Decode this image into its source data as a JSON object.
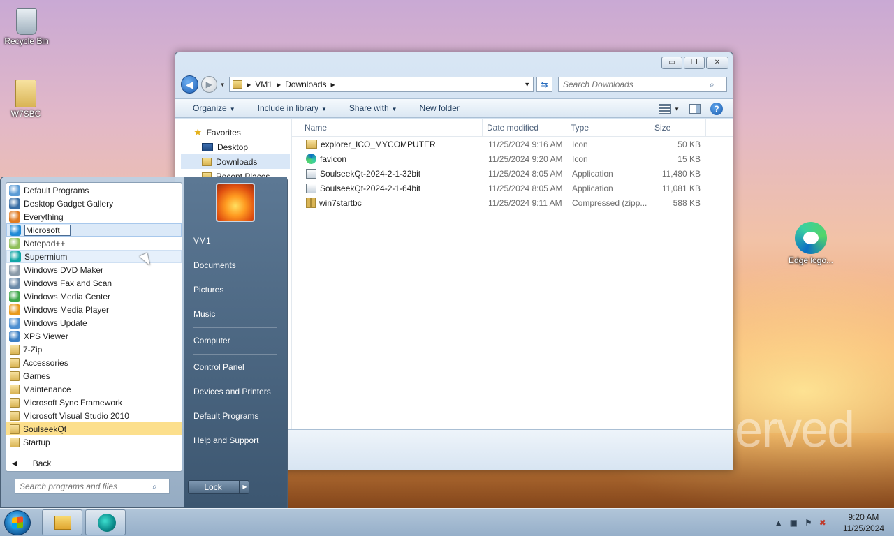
{
  "desktop": {
    "icons": [
      {
        "label": "Recycle Bin",
        "icon": "recycle-bin-icon"
      },
      {
        "label": "W7SBC",
        "icon": "folder-icon"
      },
      {
        "label": "Edge logo...",
        "icon": "edge-icon"
      }
    ],
    "wallpaper_text": "erved"
  },
  "explorer": {
    "controls": {
      "minimize": "▭",
      "maximize": "❐",
      "close": "✕"
    },
    "breadcrumb": [
      "VM1",
      "Downloads"
    ],
    "search_placeholder": "Search Downloads",
    "toolbar": {
      "organize": "Organize",
      "include_in_library": "Include in library",
      "share_with": "Share with",
      "new_folder": "New folder"
    },
    "nav": {
      "favorites": "Favorites",
      "items": [
        "Desktop",
        "Downloads",
        "Recent Places"
      ]
    },
    "columns": {
      "name": "Name",
      "date": "Date modified",
      "type": "Type",
      "size": "Size"
    },
    "files": [
      {
        "name": "explorer_ICO_MYCOMPUTER",
        "date": "11/25/2024 9:16 AM",
        "type": "Icon",
        "size": "50 KB",
        "icon": "folder"
      },
      {
        "name": "favicon",
        "date": "11/25/2024 9:20 AM",
        "type": "Icon",
        "size": "15 KB",
        "icon": "edge"
      },
      {
        "name": "SoulseekQt-2024-2-1-32bit",
        "date": "11/25/2024 8:05 AM",
        "type": "Application",
        "size": "11,480 KB",
        "icon": "setup"
      },
      {
        "name": "SoulseekQt-2024-2-1-64bit",
        "date": "11/25/2024 8:05 AM",
        "type": "Application",
        "size": "11,081 KB",
        "icon": "setup"
      },
      {
        "name": "win7startbc",
        "date": "11/25/2024 9:11 AM",
        "type": "Compressed (zipp...",
        "size": "588 KB",
        "icon": "zip"
      }
    ]
  },
  "start_menu": {
    "programs": [
      {
        "label": "Default Programs",
        "kind": "app",
        "color": "#5b9bd5"
      },
      {
        "label": "Desktop Gadget Gallery",
        "kind": "app",
        "color": "#3a6ea5"
      },
      {
        "label": "Everything",
        "kind": "app",
        "color": "#e07b22"
      },
      {
        "label": "Microsoft",
        "kind": "renaming",
        "color": "#1f8ad6"
      },
      {
        "label": "Notepad++",
        "kind": "app",
        "color": "#8fbf5a"
      },
      {
        "label": "Supermium",
        "kind": "highlight",
        "color": "#12a6a6"
      },
      {
        "label": "Windows DVD Maker",
        "kind": "app",
        "color": "#8a9aa8"
      },
      {
        "label": "Windows Fax and Scan",
        "kind": "app",
        "color": "#6b8aa8"
      },
      {
        "label": "Windows Media Center",
        "kind": "app",
        "color": "#3ea64a"
      },
      {
        "label": "Windows Media Player",
        "kind": "app",
        "color": "#e89a1c"
      },
      {
        "label": "Windows Update",
        "kind": "app",
        "color": "#4d8fd1"
      },
      {
        "label": "XPS Viewer",
        "kind": "app",
        "color": "#3b7fc4"
      },
      {
        "label": "7-Zip",
        "kind": "folder"
      },
      {
        "label": "Accessories",
        "kind": "folder"
      },
      {
        "label": "Games",
        "kind": "folder"
      },
      {
        "label": "Maintenance",
        "kind": "folder"
      },
      {
        "label": "Microsoft Sync Framework",
        "kind": "folder"
      },
      {
        "label": "Microsoft Visual Studio 2010",
        "kind": "folder"
      },
      {
        "label": "SoulseekQt",
        "kind": "open-folder"
      },
      {
        "label": "Startup",
        "kind": "folder"
      }
    ],
    "back": "Back",
    "search_placeholder": "Search programs and files",
    "places": [
      "VM1",
      "Documents",
      "Pictures",
      "Music",
      "Computer",
      "Control Panel",
      "Devices and Printers",
      "Default Programs",
      "Help and Support"
    ],
    "lock": "Lock"
  },
  "taskbar": {
    "time": "9:20 AM",
    "date": "11/25/2024"
  }
}
